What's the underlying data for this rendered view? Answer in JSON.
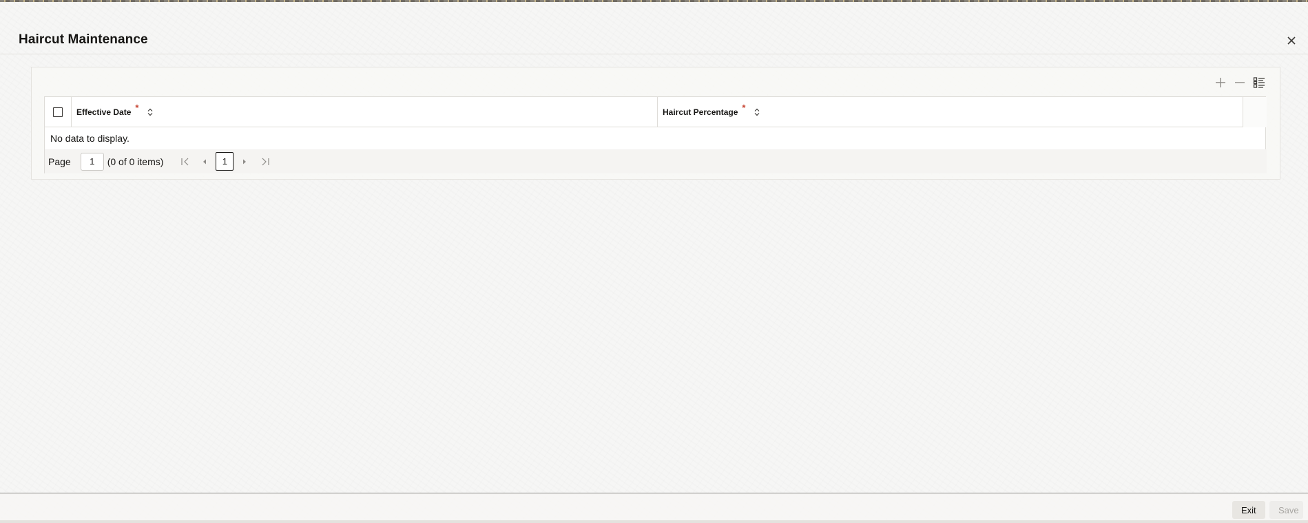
{
  "window": {
    "title": "Haircut Maintenance"
  },
  "grid": {
    "columns": [
      {
        "label": "Effective Date",
        "required_marker": "*"
      },
      {
        "label": "Haircut Percentage",
        "required_marker": "*"
      }
    ],
    "empty_message": "No data to display."
  },
  "pagination": {
    "page_label": "Page",
    "page_input_value": "1",
    "item_count": "(0 of 0 items)",
    "current_page": "1"
  },
  "footer": {
    "exit_label": "Exit",
    "save_label": "Save"
  },
  "icons": {
    "close": "close-icon",
    "add_row": "plus-icon",
    "delete_row": "minus-icon",
    "single_record_view": "list-view-icon",
    "sort": "sort-icon",
    "first_page": "first-page-icon",
    "prev_page": "prev-page-icon",
    "next_page": "next-page-icon",
    "last_page": "last-page-icon"
  },
  "colors": {
    "required": "#c74634",
    "text": "#161513",
    "disabled_text": "#a8a6a2"
  }
}
